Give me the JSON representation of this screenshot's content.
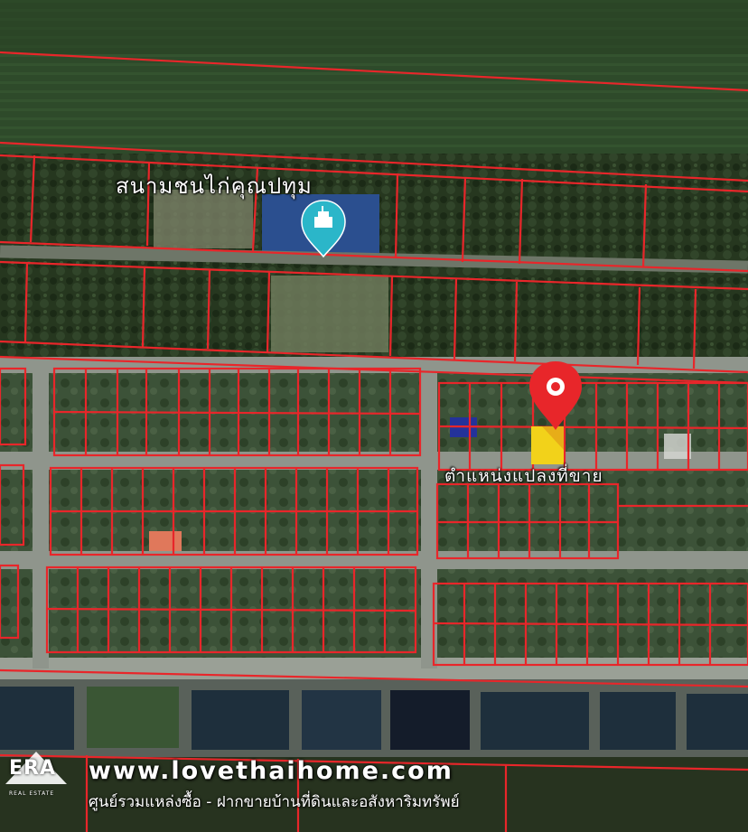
{
  "map": {
    "place_label": "สนามชนไก่คุณปทุม",
    "place_icon": "stadium-pin-icon",
    "parcel_label": "ตำแหน่งแปลงที่ขาย",
    "target_pin_icon": "location-pin-icon",
    "colors": {
      "boundary": "#e8262a",
      "pin": "#e8262a",
      "highlight": "#f2d21a",
      "place_pin": "#2bb6c9",
      "road": "#8f958c",
      "field": "#2f4a2a",
      "trees": "#26371f",
      "pond": "#1e2f3c"
    }
  },
  "watermark": {
    "brand": "ERA",
    "brand_sub": "REAL ESTATE",
    "url": "www.lovethaihome.com",
    "tagline": "ศูนย์รวมแหล่งซื้อ - ฝากขายบ้านที่ดินและอสังหาริมทรัพย์"
  }
}
